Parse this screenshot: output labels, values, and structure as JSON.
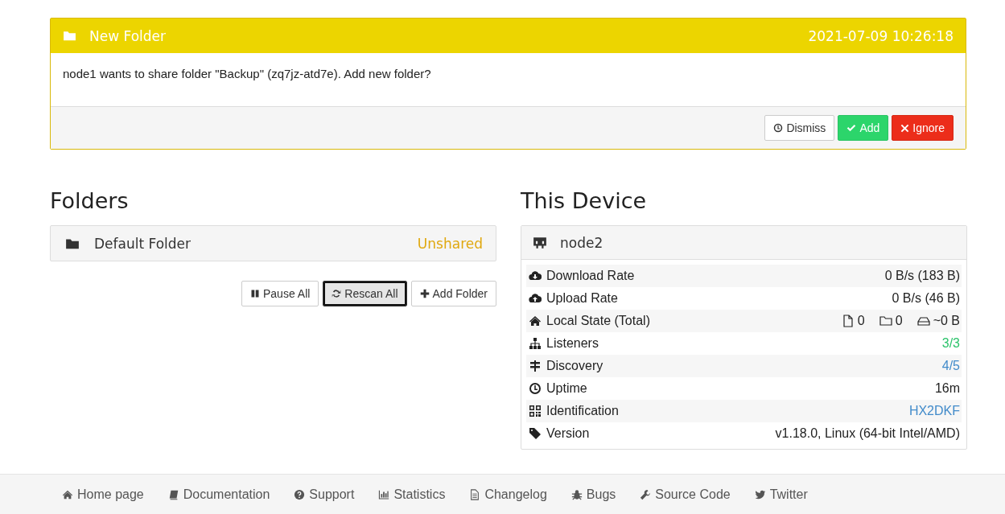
{
  "notification": {
    "title": "New Folder",
    "time": "2021-07-09 10:26:18",
    "message": "node1 wants to share folder \"Backup\" (zq7jz-atd7e). Add new folder?",
    "buttons": [
      {
        "label": "Dismiss",
        "kind": "default"
      },
      {
        "label": "Add",
        "kind": "success"
      },
      {
        "label": "Ignore",
        "kind": "danger"
      }
    ]
  },
  "folders": {
    "heading": "Folders",
    "items": [
      {
        "name": "Default Folder",
        "status": "Unshared"
      }
    ],
    "buttons": [
      {
        "label": "Pause All",
        "focused": false
      },
      {
        "label": "Rescan All",
        "focused": true
      },
      {
        "label": "Add Folder",
        "focused": false
      }
    ]
  },
  "device": {
    "heading": "This Device",
    "name": "node2",
    "rows": [
      {
        "label": "Download Rate",
        "kind": "text",
        "value": "0 B/s (183 B)"
      },
      {
        "label": "Upload Rate",
        "kind": "text",
        "value": "0 B/s (46 B)"
      },
      {
        "label": "Local State (Total)",
        "kind": "counts",
        "files": "0",
        "dirs": "0",
        "size": "~0 B"
      },
      {
        "label": "Listeners",
        "kind": "text",
        "value": "3/3",
        "color": "#2cc36b"
      },
      {
        "label": "Discovery",
        "kind": "text",
        "value": "4/5",
        "color": "#428bca"
      },
      {
        "label": "Uptime",
        "kind": "text",
        "value": "16m"
      },
      {
        "label": "Identification",
        "kind": "text",
        "value": "HX2DKF",
        "color": "#428bca"
      },
      {
        "label": "Version",
        "kind": "text",
        "value": "v1.18.0, Linux (64-bit Intel/AMD)"
      }
    ]
  },
  "footer_links": [
    "Home page",
    "Documentation",
    "Support",
    "Statistics",
    "Changelog",
    "Bugs",
    "Source Code",
    "Twitter"
  ]
}
